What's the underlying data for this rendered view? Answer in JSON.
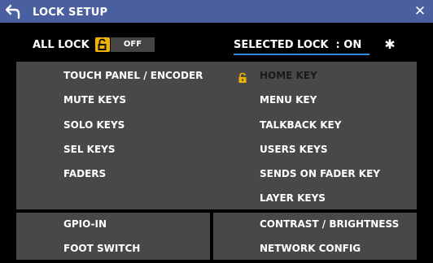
{
  "header": {
    "title": "LOCK SETUP"
  },
  "controls": {
    "all_lock_label": "ALL LOCK",
    "all_lock_value": "OFF",
    "selected_lock": "SELECTED LOCK  : ON"
  },
  "left_items": [
    "TOUCH PANEL / ENCODER",
    "MUTE KEYS",
    "SOLO KEYS",
    "SEL KEYS",
    "FADERS"
  ],
  "right_items": [
    "HOME KEY",
    "MENU KEY",
    "TALKBACK KEY",
    "USERS KEYS",
    "SENDS ON FADER KEY",
    "LAYER KEYS"
  ],
  "bottom_left_items": [
    "GPIO-IN",
    "FOOT SWITCH"
  ],
  "bottom_right_items": [
    "CONTRAST / BRIGHTNESS",
    "NETWORK CONFIG"
  ],
  "icons": {
    "back": "back-arrow-icon",
    "close": "close-icon",
    "settings": "gear-icon",
    "lock_open": "unlock-icon",
    "lock_closed": "lock-icon"
  },
  "colors": {
    "title_bar": "#4a5f9f",
    "panel": "#484848",
    "lock_yellow": "#f0b400",
    "accent_underline": "#2d8cdc"
  }
}
